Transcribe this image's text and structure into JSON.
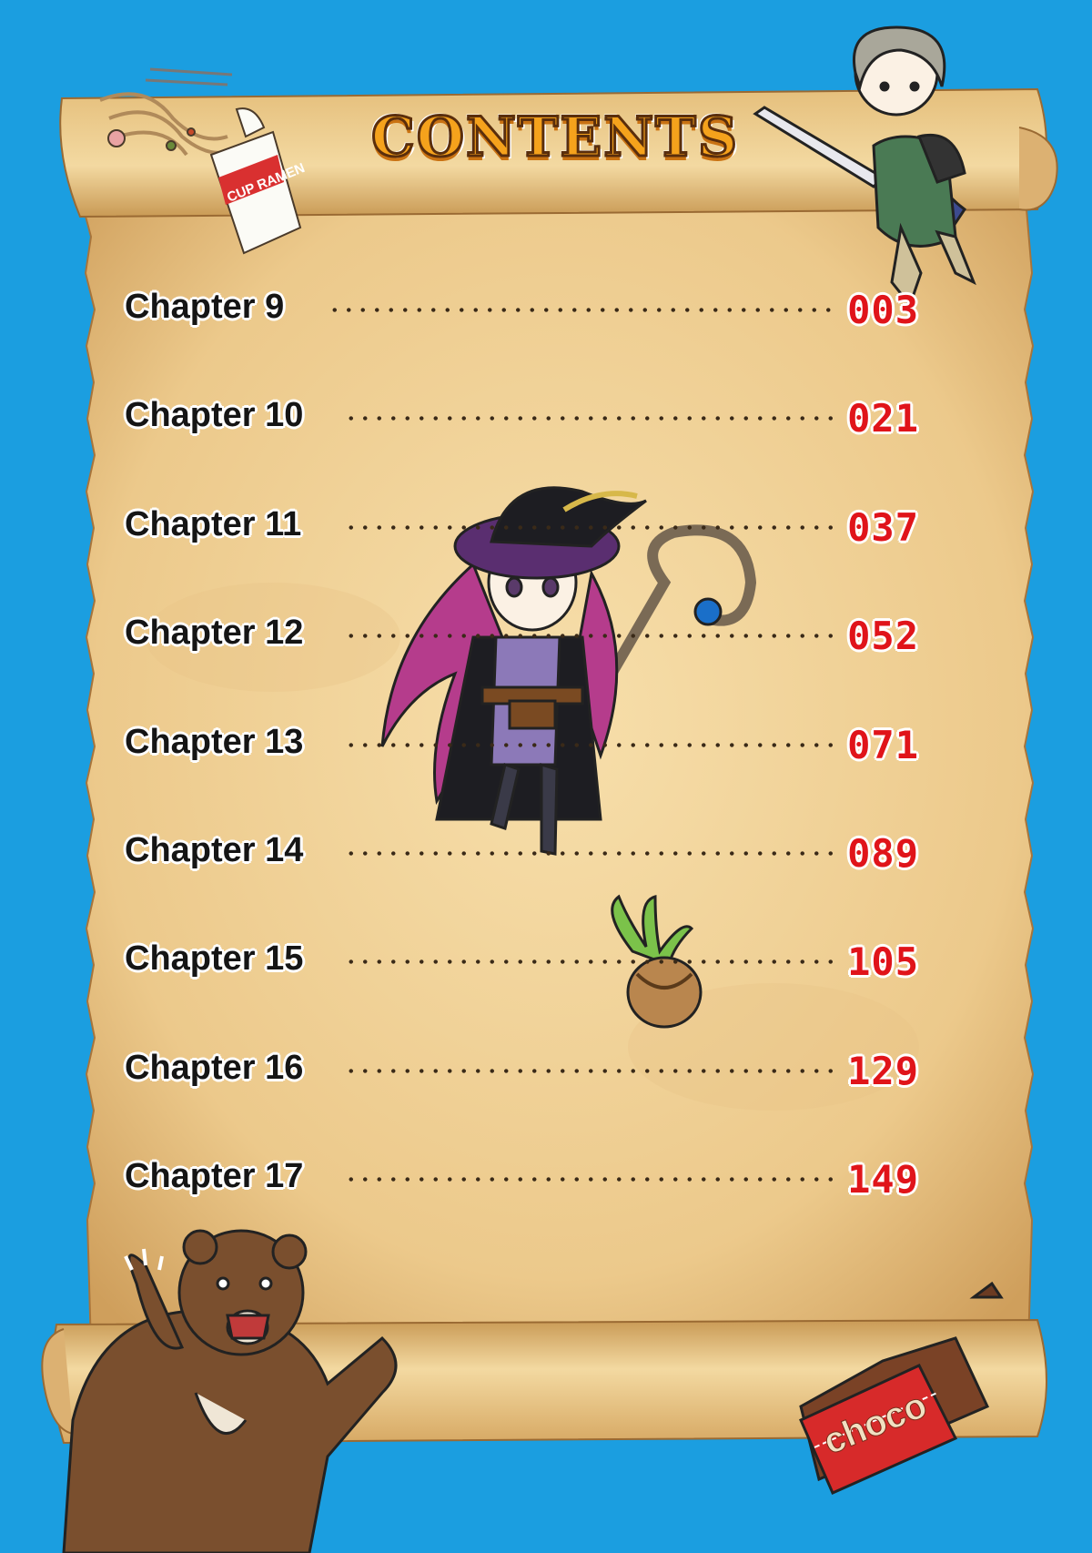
{
  "title": "CONTENTS",
  "chapters": [
    {
      "label": "Chapter 9",
      "page": "003"
    },
    {
      "label": "Chapter 10",
      "page": "021"
    },
    {
      "label": "Chapter 11",
      "page": "037"
    },
    {
      "label": "Chapter 12",
      "page": "052"
    },
    {
      "label": "Chapter 13",
      "page": "071"
    },
    {
      "label": "Chapter 14",
      "page": "089"
    },
    {
      "label": "Chapter 15",
      "page": "105"
    },
    {
      "label": "Chapter 16",
      "page": "129"
    },
    {
      "label": "Chapter 17",
      "page": "149"
    }
  ],
  "decorations": {
    "cup_ramen_text": "CUP RAMEN",
    "chocolate_text": "choco"
  },
  "colors": {
    "background": "#1b9ee0",
    "scroll": "#f0d49a",
    "title_fill": "#f5a21c",
    "page_number": "#e0141a"
  }
}
